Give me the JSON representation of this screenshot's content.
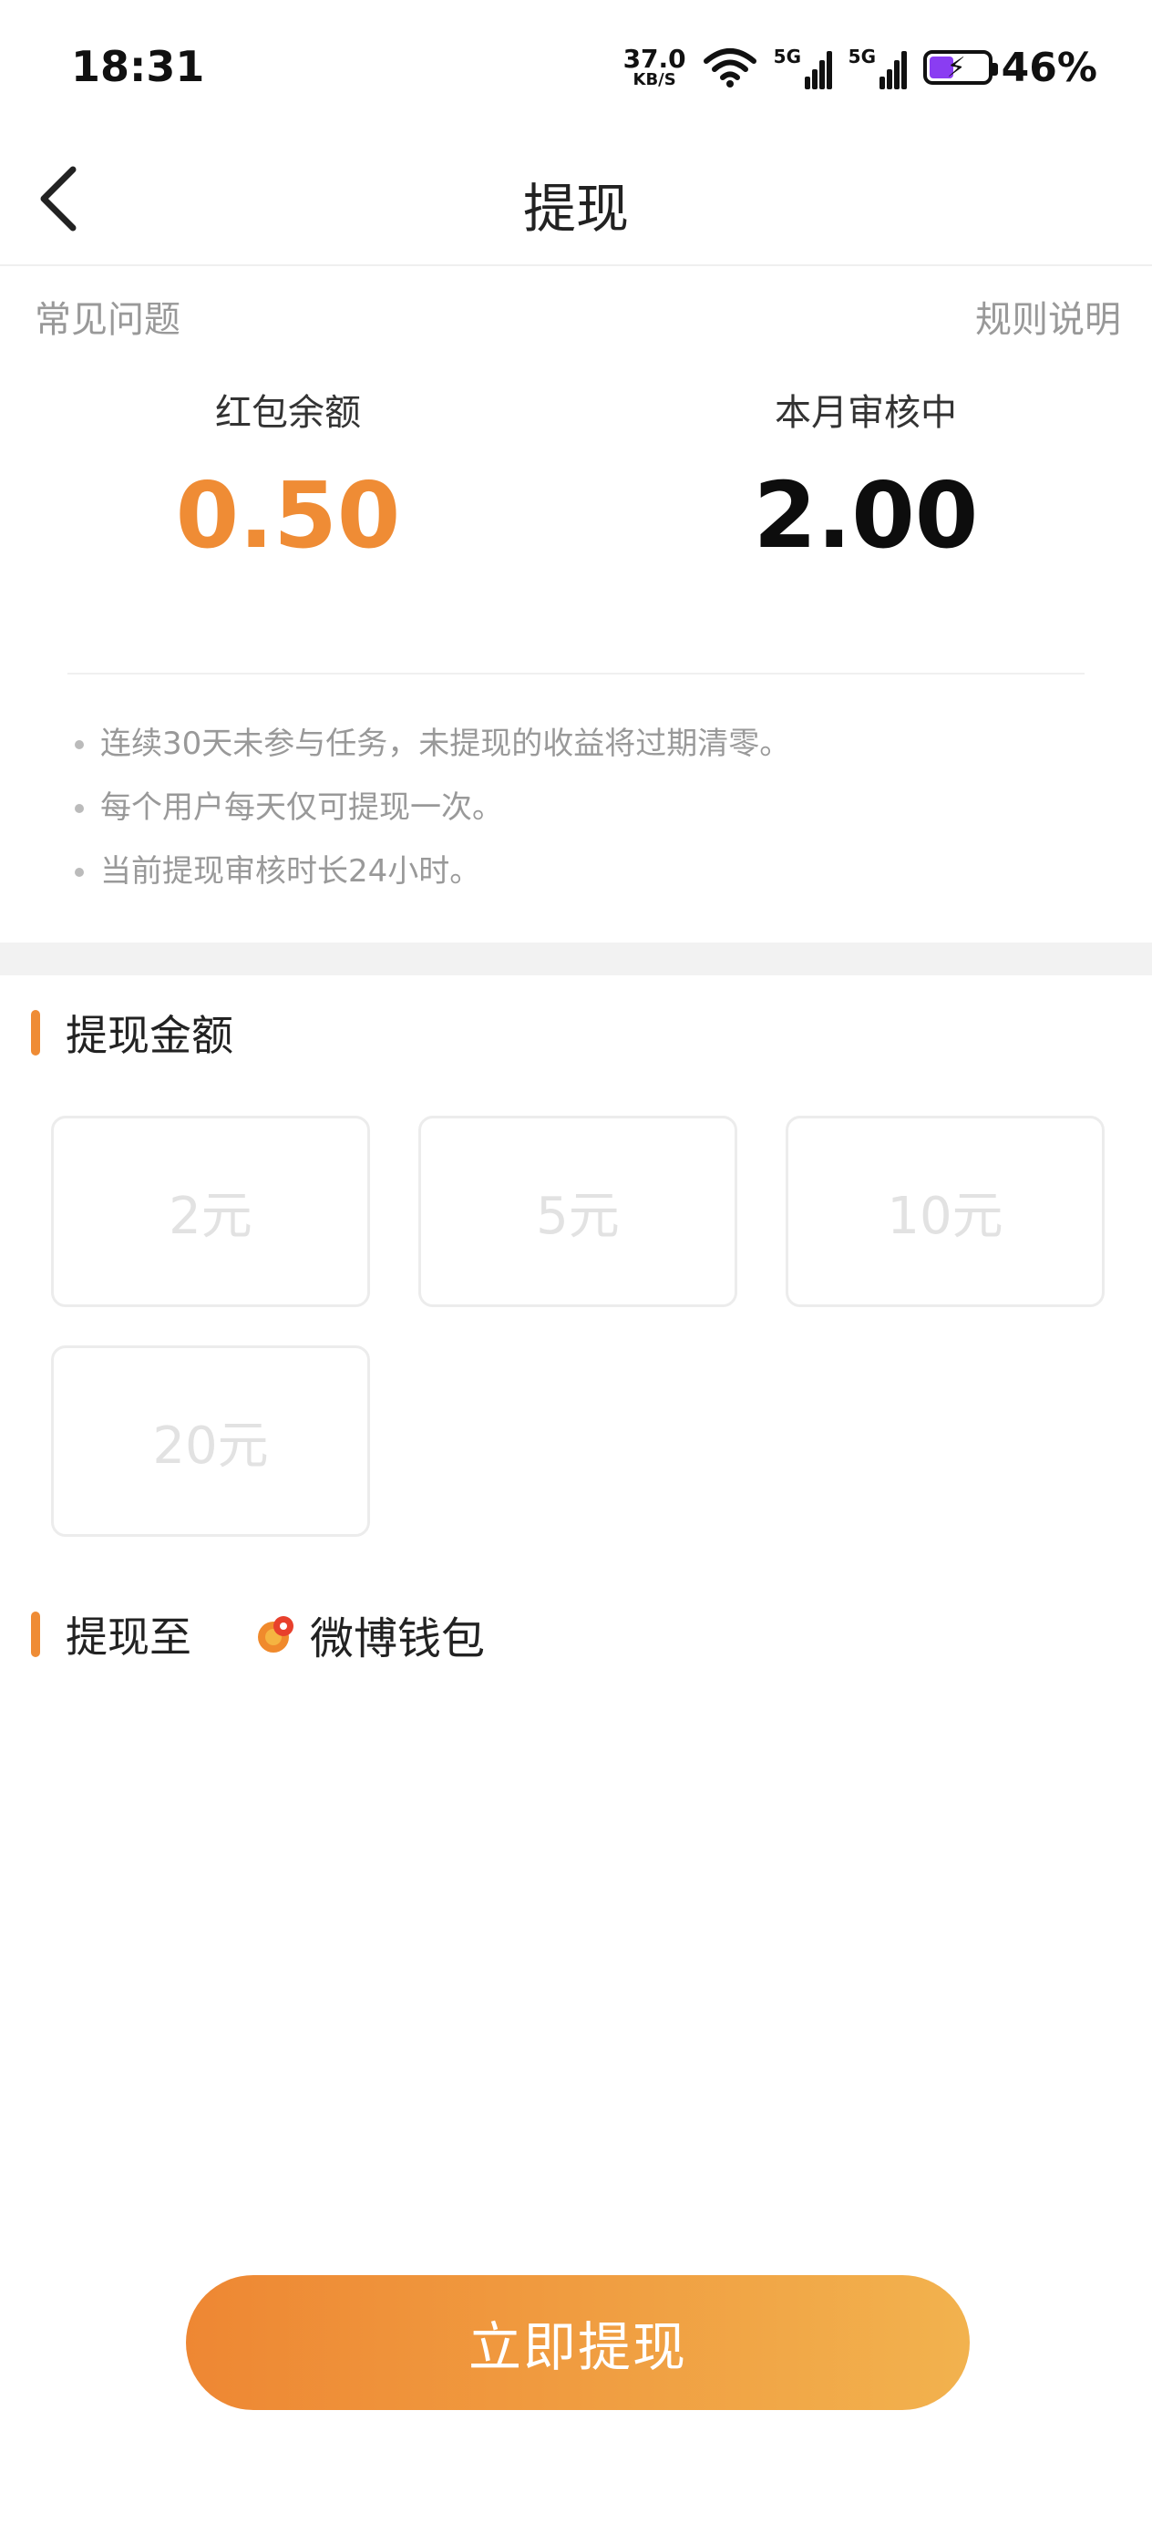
{
  "status_bar": {
    "time": "18:31",
    "net_speed_value": "37.0",
    "net_speed_unit": "KB/S",
    "sim1_type": "5G",
    "sim2_type": "5G",
    "battery_percent": "46%"
  },
  "nav": {
    "title": "提现",
    "back_icon": "chevron-left-icon"
  },
  "links": {
    "faq": "常见问题",
    "rules": "规则说明"
  },
  "stats": {
    "balance_label": "红包余额",
    "balance_value": "0.50",
    "reviewing_label": "本月审核中",
    "reviewing_value": "2.00"
  },
  "notes": [
    "连续30天未参与任务，未提现的收益将过期清零。",
    "每个用户每天仅可提现一次。",
    "当前提现审核时长24小时。"
  ],
  "amount_section": {
    "title": "提现金额",
    "options": [
      "2元",
      "5元",
      "10元",
      "20元"
    ]
  },
  "destination": {
    "title": "提现至",
    "wallet_name": "微博钱包",
    "wallet_icon": "weibo-wallet-icon"
  },
  "submit_label": "立即提现",
  "colors": {
    "accent": "#ef8c35",
    "button_gradient_start": "#ee8733",
    "button_gradient_end": "#f2b24e",
    "muted_text": "#999999"
  }
}
